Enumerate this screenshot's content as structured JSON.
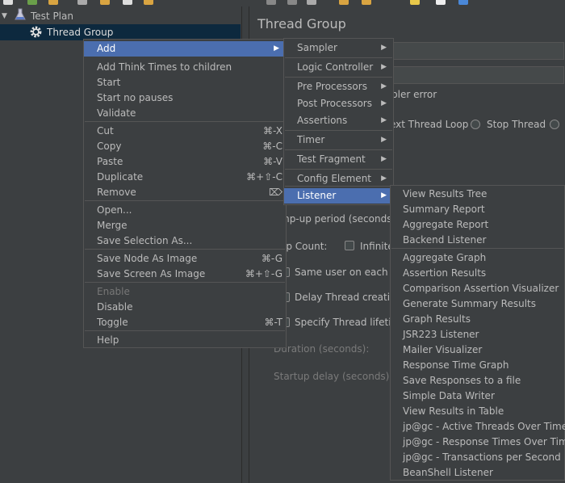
{
  "tree": {
    "test_plan": "Test Plan",
    "thread_group": "Thread Group"
  },
  "panel": {
    "title": "Thread Group",
    "on_error_label": "pler error",
    "next_loop": "ext Thread Loop",
    "stop_thread": "Stop Thread",
    "rampup": "mp-up period (seconds):",
    "loop_count": "op Count:",
    "infinite": "Infinite",
    "same_user": "Same user on each ite",
    "delay_thread": "Delay Thread creation",
    "specify_lifetime": "Specify Thread lifetim",
    "duration": "Duration (seconds):",
    "startup_delay": "Startup delay (seconds):"
  },
  "context_menu": [
    {
      "label": "Add",
      "shortcut": "",
      "submenu": true,
      "highlighted": true
    },
    {
      "label": "Add Think Times to children",
      "shortcut": ""
    },
    {
      "label": "Start",
      "shortcut": ""
    },
    {
      "label": "Start no pauses",
      "shortcut": ""
    },
    {
      "label": "Validate",
      "shortcut": ""
    },
    {
      "label": "Cut",
      "shortcut": "⌘-X"
    },
    {
      "label": "Copy",
      "shortcut": "⌘-C"
    },
    {
      "label": "Paste",
      "shortcut": "⌘-V"
    },
    {
      "label": "Duplicate",
      "shortcut": "⌘+⇧-C"
    },
    {
      "label": "Remove",
      "shortcut": "⌦"
    },
    {
      "label": "Open...",
      "shortcut": ""
    },
    {
      "label": "Merge",
      "shortcut": ""
    },
    {
      "label": "Save Selection As...",
      "shortcut": ""
    },
    {
      "label": "Save Node As Image",
      "shortcut": "⌘-G"
    },
    {
      "label": "Save Screen As Image",
      "shortcut": "⌘+⇧-G"
    },
    {
      "label": "Enable",
      "shortcut": "",
      "disabled": true
    },
    {
      "label": "Disable",
      "shortcut": ""
    },
    {
      "label": "Toggle",
      "shortcut": "⌘-T"
    },
    {
      "label": "Help",
      "shortcut": ""
    }
  ],
  "add_menu": [
    {
      "label": "Sampler"
    },
    {
      "label": "Logic Controller"
    },
    {
      "label": "Pre Processors"
    },
    {
      "label": "Post Processors"
    },
    {
      "label": "Assertions"
    },
    {
      "label": "Timer"
    },
    {
      "label": "Test Fragment"
    },
    {
      "label": "Config Element"
    },
    {
      "label": "Listener",
      "highlighted": true
    }
  ],
  "listener_menu": [
    "View Results Tree",
    "Summary Report",
    "Aggregate Report",
    "Backend Listener",
    "Aggregate Graph",
    "Assertion Results",
    "Comparison Assertion Visualizer",
    "Generate Summary Results",
    "Graph Results",
    "JSR223 Listener",
    "Mailer Visualizer",
    "Response Time Graph",
    "Save Responses to a file",
    "Simple Data Writer",
    "View Results in Table",
    "jp@gc - Active Threads Over Time",
    "jp@gc - Response Times Over Time",
    "jp@gc - Transactions per Second",
    "BeanShell Listener"
  ],
  "colors": {
    "background": "#3c3f41",
    "menu_highlight": "#4b6eaf",
    "tree_selection": "#0d293e"
  }
}
